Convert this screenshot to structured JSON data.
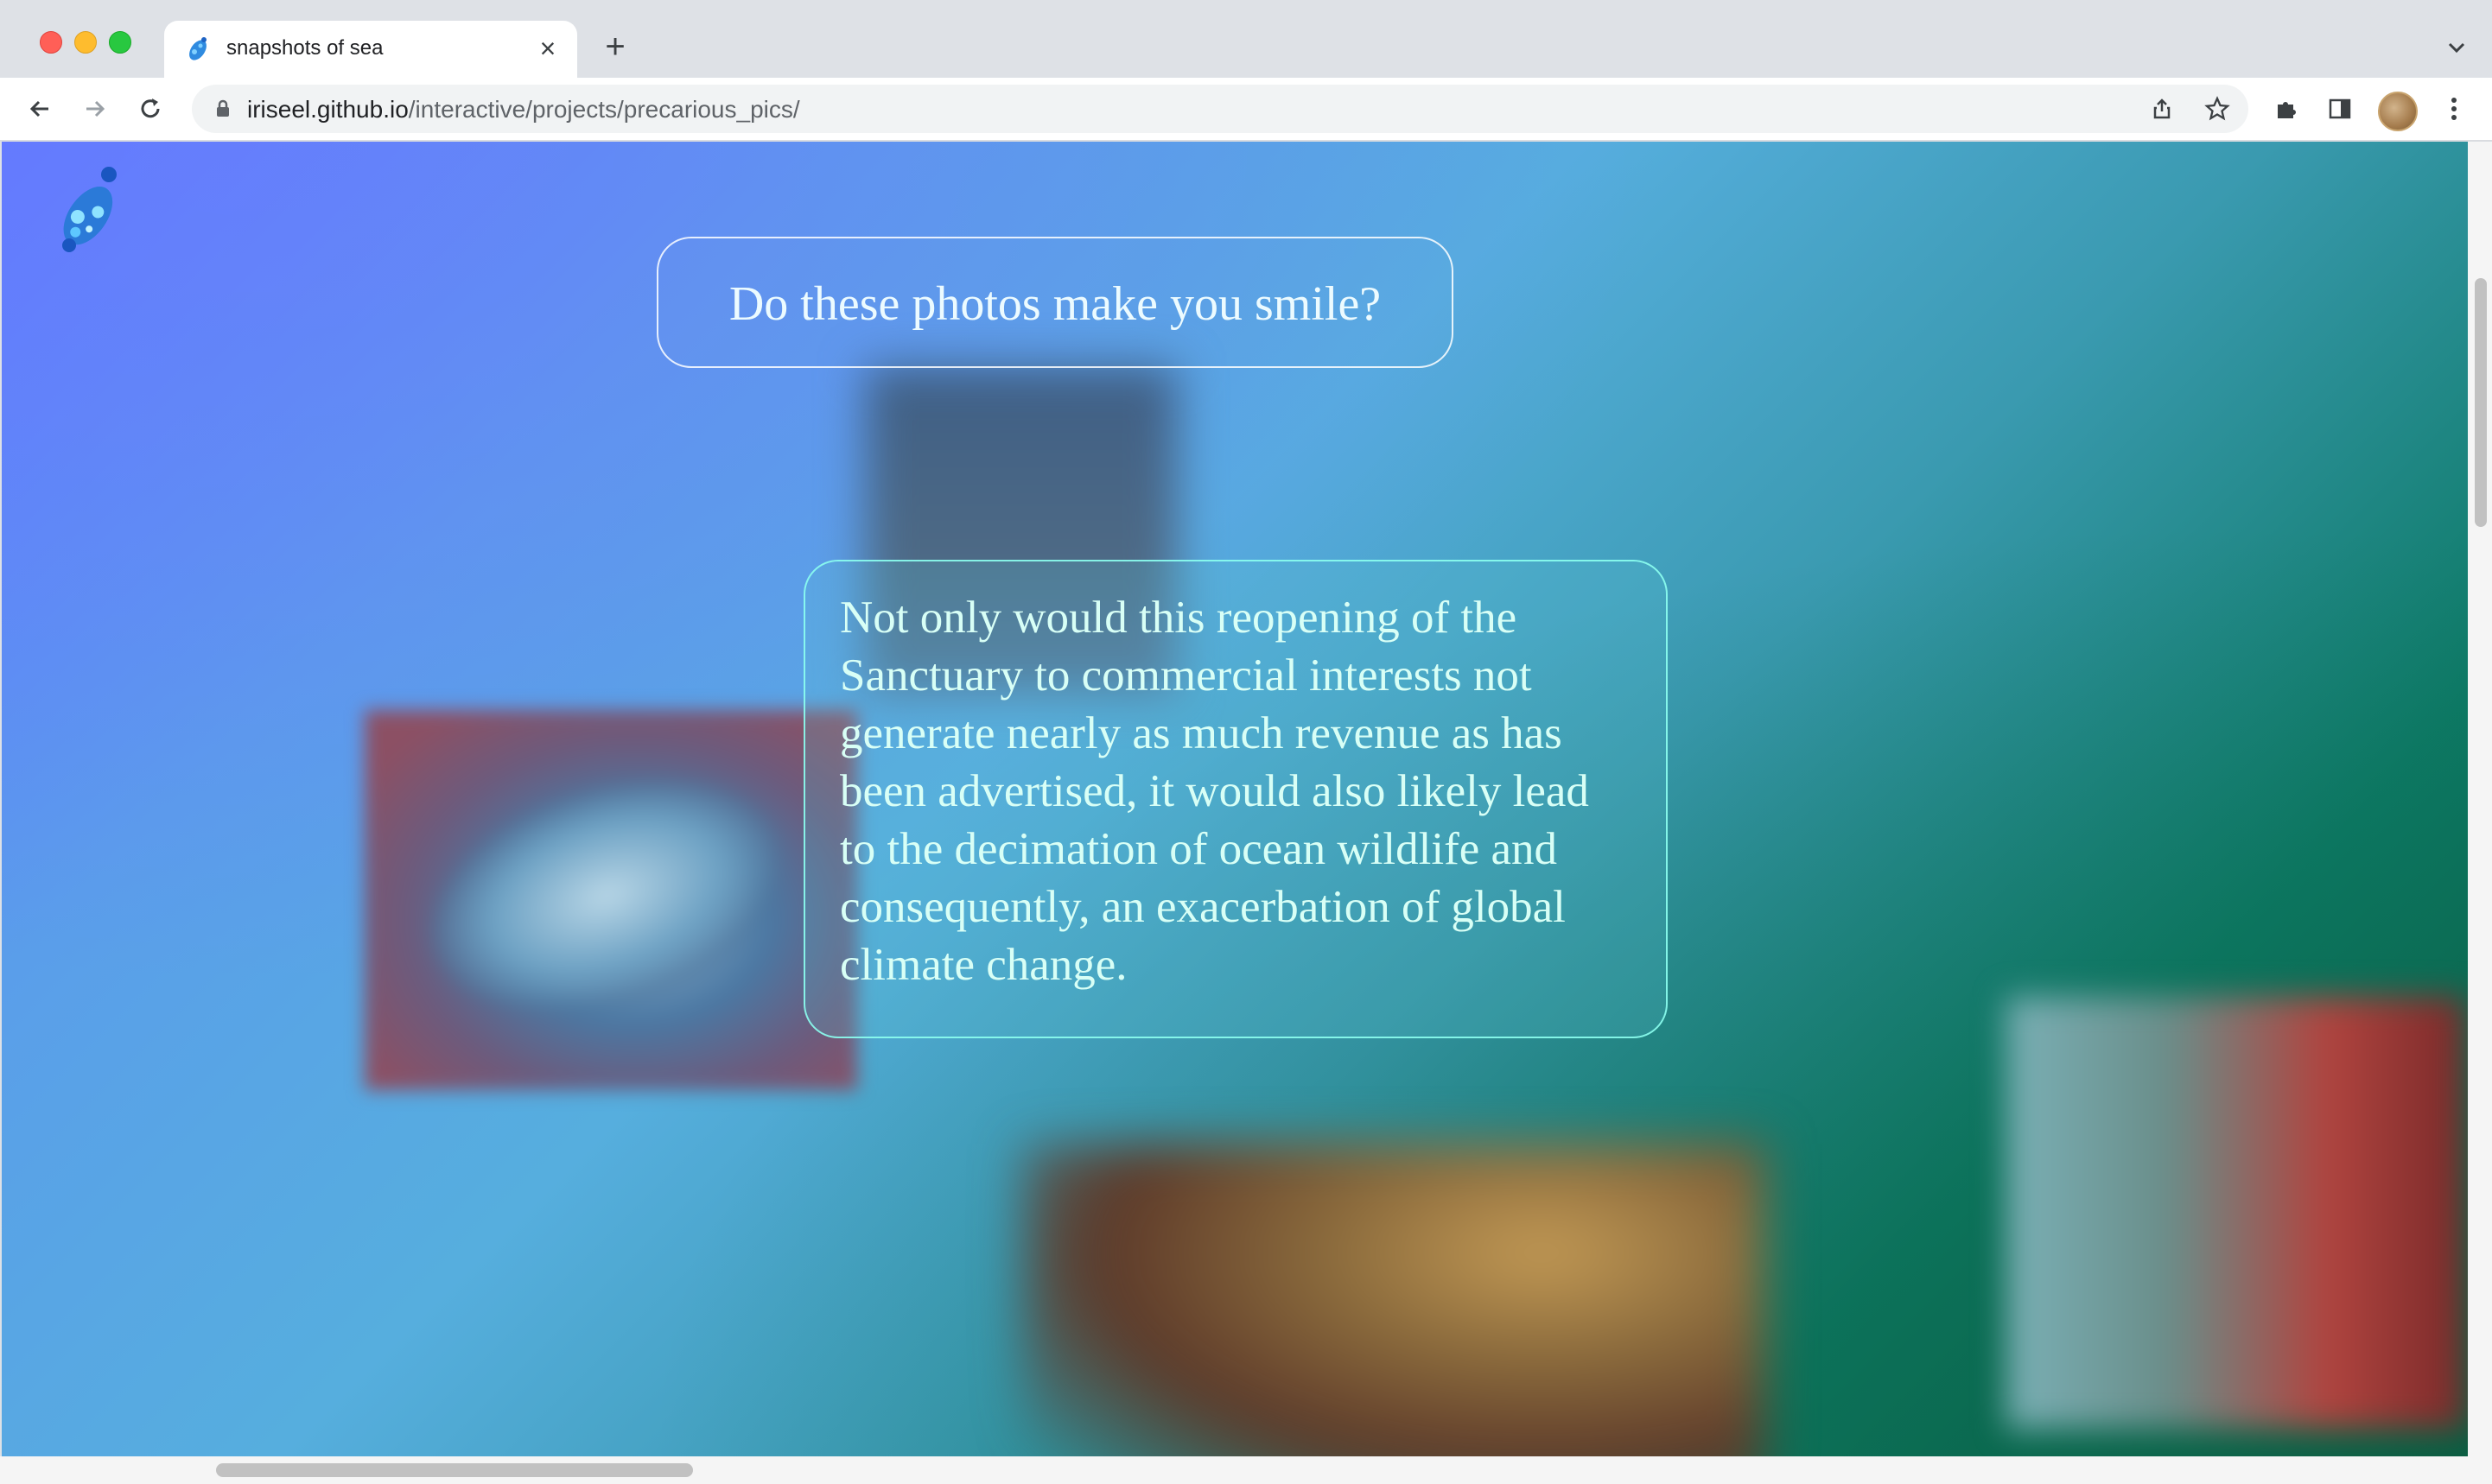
{
  "browser": {
    "tab": {
      "title": "snapshots of sea",
      "favicon": "fish-logo-icon"
    },
    "address": {
      "domain": "iriseel.github.io",
      "path": "/interactive/projects/precarious_pics/"
    },
    "icons": [
      "back-icon",
      "forward-icon",
      "reload-icon",
      "lock-icon",
      "share-icon",
      "bookmark-star-icon",
      "extensions-icon",
      "side-panel-icon",
      "avatar",
      "more-menu-icon",
      "new-tab-icon",
      "close-tab-icon",
      "tab-search-chevron-icon"
    ]
  },
  "page": {
    "question": "Do these photos make you smile?",
    "body_text": "Not only would this reopening of the Sanctuary to commercial interests not generate nearly as much revenue as has been advertised, it would also likely lead to the decimation of ocean wildlife and consequently, an exacerbation of global climate change.",
    "colors": {
      "gradient_start": "#5b7cff",
      "gradient_mid": "#56aede",
      "gradient_end": "#0a5a40",
      "bubble_border": "#ffffff",
      "text_bubble_border": "#8cfff0"
    }
  }
}
